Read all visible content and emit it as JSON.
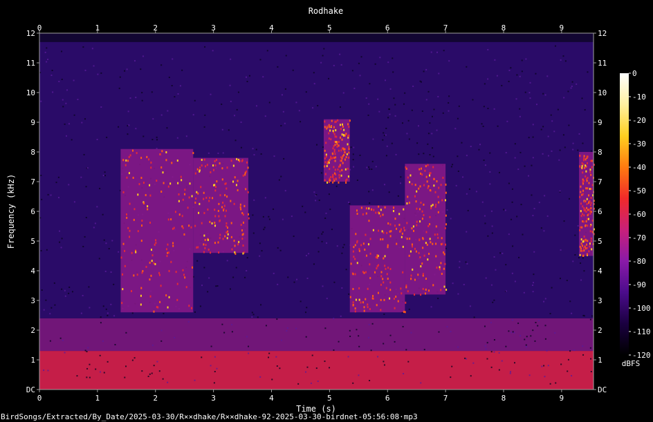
{
  "chart_data": {
    "type": "heatmap",
    "title": "Rodhake",
    "xlabel": "Time (s)",
    "ylabel": "Frequency (kHz)",
    "xlim": [
      0,
      9.55
    ],
    "ylim": [
      0,
      12
    ],
    "x_ticks": [
      "0",
      "1",
      "2",
      "3",
      "4",
      "5",
      "6",
      "7",
      "8",
      "9"
    ],
    "y_ticks": [
      "DC",
      "1",
      "2",
      "3",
      "4",
      "5",
      "6",
      "7",
      "8",
      "9",
      "10",
      "11",
      "12"
    ],
    "colorbar": {
      "unit": "dBFS",
      "range": [
        -120,
        0
      ],
      "ticks": [
        "0",
        "-10",
        "-20",
        "-30",
        "-40",
        "-50",
        "-60",
        "-70",
        "-80",
        "-90",
        "-100",
        "-110",
        "-120"
      ],
      "colors": [
        "#000000",
        "#1a0040",
        "#4b0c8c",
        "#8a1aa8",
        "#c8207a",
        "#f02a2a",
        "#ff7a10",
        "#ffd020",
        "#fff0a0",
        "#ffffff"
      ]
    },
    "calls": [
      {
        "start": 1.4,
        "end": 2.65,
        "low_khz": 2.6,
        "high_khz": 8.1
      },
      {
        "start": 2.65,
        "end": 3.6,
        "low_khz": 4.6,
        "high_khz": 7.8
      },
      {
        "start": 4.9,
        "end": 5.35,
        "low_khz": 7.0,
        "high_khz": 9.1
      },
      {
        "start": 5.35,
        "end": 6.3,
        "low_khz": 2.6,
        "high_khz": 6.2
      },
      {
        "start": 6.3,
        "end": 7.0,
        "low_khz": 3.2,
        "high_khz": 7.6
      },
      {
        "start": 9.3,
        "end": 9.55,
        "low_khz": 4.5,
        "high_khz": 8.0
      }
    ]
  },
  "footer_path": "BirdSongs/Extracted/By_Date/2025-03-30/R××dhake/R××dhake-92-2025-03-30-birdnet-05:56:08⋅mp3"
}
